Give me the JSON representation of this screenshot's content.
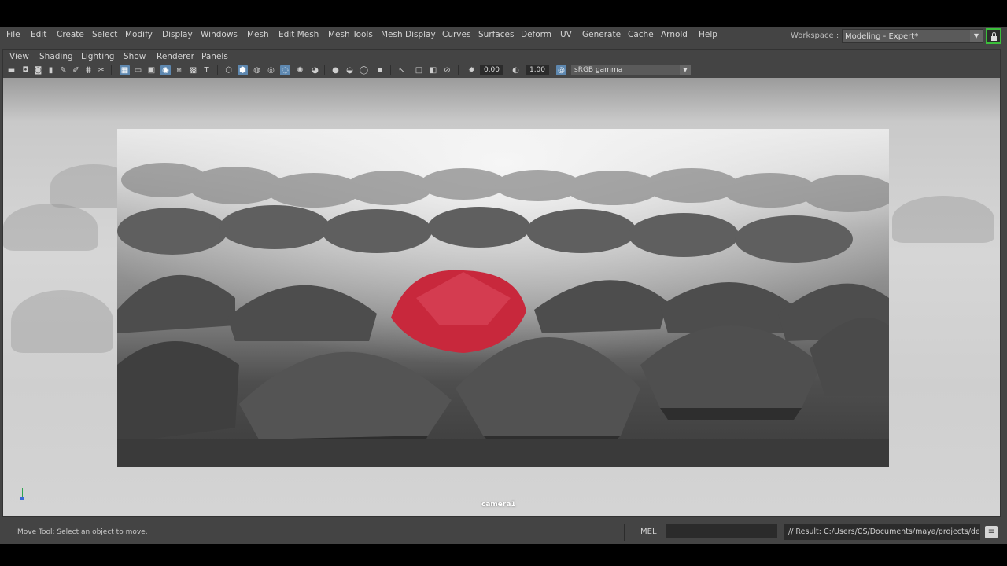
{
  "menu": [
    "File",
    "Edit",
    "Create",
    "Select",
    "Modify",
    "Display",
    "Windows",
    "Mesh",
    "Edit Mesh",
    "Mesh Tools",
    "Mesh Display",
    "Curves",
    "Surfaces",
    "Deform",
    "UV",
    "Generate",
    "Cache",
    "Arnold",
    "Help"
  ],
  "workspace": {
    "label": "Workspace :",
    "value": "Modeling - Expert*"
  },
  "panel_menu": [
    "View",
    "Shading",
    "Lighting",
    "Show",
    "Renderer",
    "Panels"
  ],
  "toolbar": {
    "exposure": "0.00",
    "gamma_value": "1.00",
    "color_space": "sRGB gamma"
  },
  "viewport": {
    "camera_label": "camera1"
  },
  "status": {
    "help_text": "Move Tool: Select an object to move.",
    "mel_label": "MEL",
    "result_text": "// Result: C:/Users/CS/Documents/maya/projects/de"
  },
  "colors": {
    "accent_active": "#5e88b0",
    "lock_border": "#3bbf3b",
    "red_umbrella": "#c8283c"
  }
}
